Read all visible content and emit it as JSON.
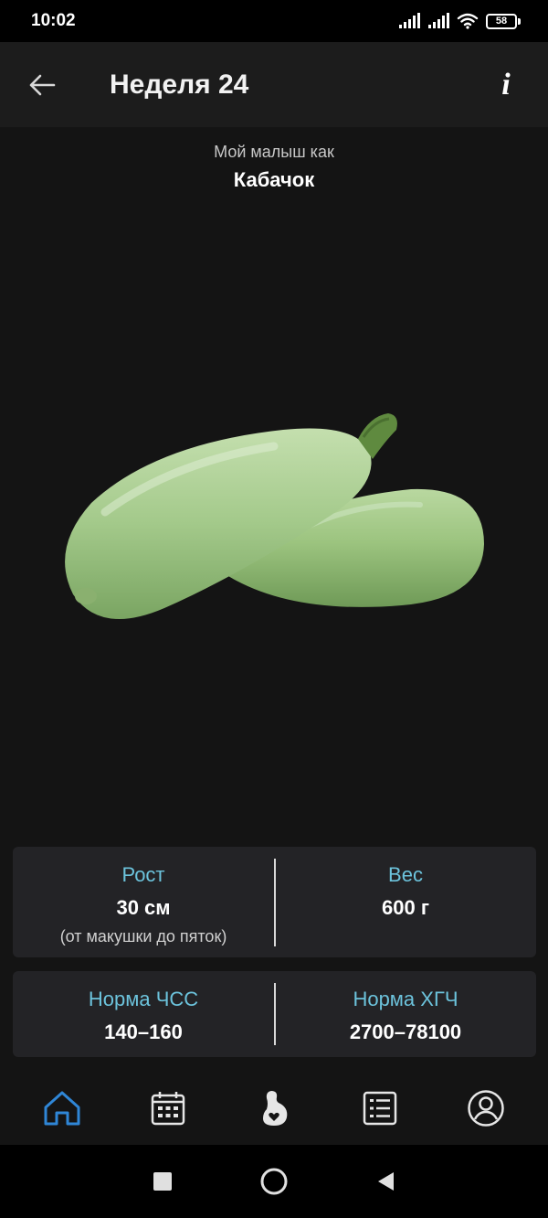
{
  "status_bar": {
    "time": "10:02",
    "battery": "58"
  },
  "app_bar": {
    "title": "Неделя 24",
    "info_label": "i"
  },
  "fruit": {
    "caption": "Мой малыш как",
    "name": "Кабачок"
  },
  "stats": {
    "height": {
      "label": "Рост",
      "value": "30 см",
      "note": "(от макушки до пяток)"
    },
    "weight": {
      "label": "Вес",
      "value": "600 г"
    },
    "heart_rate": {
      "label": "Норма ЧСС",
      "value": "140–160"
    },
    "hcg": {
      "label": "Норма ХГЧ",
      "value": "2700–78100"
    }
  },
  "bottom_nav": {
    "items": [
      {
        "icon": "home-icon",
        "active": true
      },
      {
        "icon": "calendar-icon",
        "active": false
      },
      {
        "icon": "pregnancy-icon",
        "active": false
      },
      {
        "icon": "list-icon",
        "active": false
      },
      {
        "icon": "profile-icon",
        "active": false
      }
    ]
  },
  "colors": {
    "background": "#141414",
    "app_bar": "#1c1c1c",
    "card": "#232326",
    "accent_label": "#6cc3dc",
    "nav_active": "#2f86d6",
    "nav_inactive": "#e6e6e6"
  }
}
